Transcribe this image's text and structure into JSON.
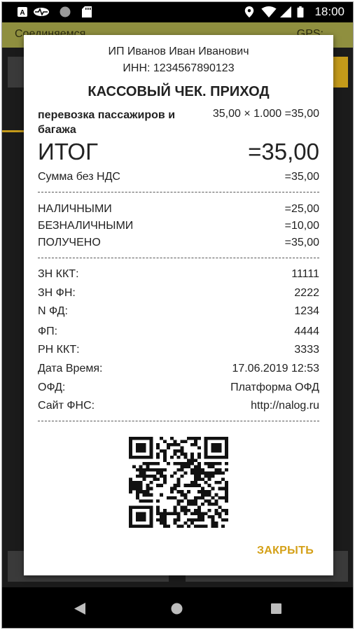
{
  "status_bar": {
    "time": "18:00"
  },
  "app_background": {
    "connection_text": "Соединяемся",
    "gps_label": "GPS:"
  },
  "receipt": {
    "seller": "ИП Иванов Иван Иванович",
    "inn": "ИНН: 1234567890123",
    "title": "КАССОВЫЙ ЧЕК. ПРИХОД",
    "item_name_line1": "перевозка пассажиров и",
    "item_name_line2": "багажа",
    "item_calc": "35,00 × 1.000 =35,00",
    "total_label": "ИТОГ",
    "total_value": "=35,00",
    "vat_label": "Сумма без НДС",
    "vat_value": "=35,00",
    "payments": [
      {
        "label": "НАЛИЧНЫМИ",
        "value": "=25,00"
      },
      {
        "label": "БЕЗНАЛИЧНЫМИ",
        "value": "=10,00"
      },
      {
        "label": "ПОЛУЧЕНО",
        "value": "=35,00"
      }
    ],
    "details": [
      {
        "label": "ЗН ККТ:",
        "value": "11111"
      },
      {
        "label": "ЗН ФН:",
        "value": "2222"
      },
      {
        "label": "N ФД:",
        "value": "1234"
      },
      {
        "label": "ФП:",
        "value": "4444"
      },
      {
        "label": "РН ККТ:",
        "value": "3333"
      },
      {
        "label": "Дата Время:",
        "value": "17.06.2019 12:53"
      },
      {
        "label": "ОФД:",
        "value": "Платформа ОФД"
      },
      {
        "label": "Сайт ФНС:",
        "value": "http://nalog.ru"
      }
    ],
    "close_label": "ЗАКРЫТЬ"
  },
  "colors": {
    "accent": "#d4a017",
    "app_bar": "#8f8f3f"
  },
  "icons": [
    "a-box-icon",
    "heartbeat-icon",
    "circle-icon",
    "sd-card-icon",
    "location-icon",
    "wifi-icon",
    "battery-icon",
    "back-icon",
    "home-icon",
    "recents-icon",
    "qr-code-icon"
  ]
}
